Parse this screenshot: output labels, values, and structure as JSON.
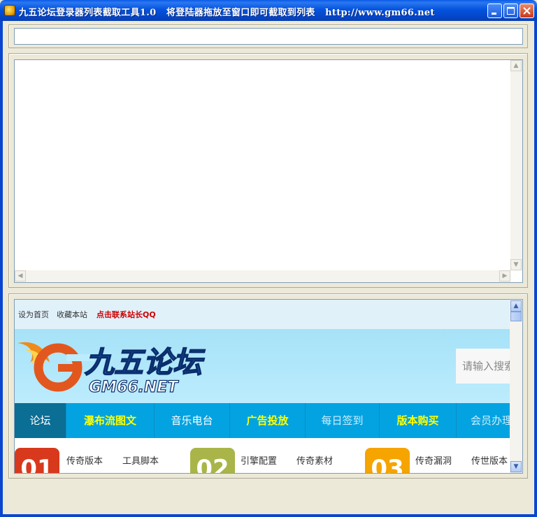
{
  "window": {
    "title": "九五论坛登录器列表截取工具1.0   将登陆器拖放至窗口即可截取到列表   http://www.gm66.net",
    "minimize_label": "_",
    "maximize_label": "□",
    "close_label": "×"
  },
  "url_field": {
    "value": ""
  },
  "list_box": {
    "items": []
  },
  "browser": {
    "top_links": [
      "设为首页",
      "收藏本站",
      "点击联系站长QQ"
    ],
    "logo_text": "九五论坛",
    "logo_sub": "GM66.NET",
    "search_placeholder": "请输入搜索",
    "nav": [
      "论坛",
      "瀑布流图文",
      "音乐电台",
      "广告投放",
      "每日签到",
      "版本购买",
      "会员办理"
    ],
    "categories": [
      {
        "badge": "01",
        "color": "#d8391c",
        "links": [
          "传奇版本",
          "工具脚本"
        ]
      },
      {
        "badge": "02",
        "color": "#a9b548",
        "links": [
          "引擎配置",
          "传奇素材"
        ]
      },
      {
        "badge": "03",
        "color": "#f5a400",
        "links": [
          "传奇漏洞",
          "传世版本"
        ]
      }
    ]
  },
  "colors": {
    "titlebar": "#0553de",
    "nav_bg": "#03a3e1",
    "nav_active": "#0a6e95",
    "highlight_text": "#ffff00",
    "contact_link": "#cc0000"
  }
}
